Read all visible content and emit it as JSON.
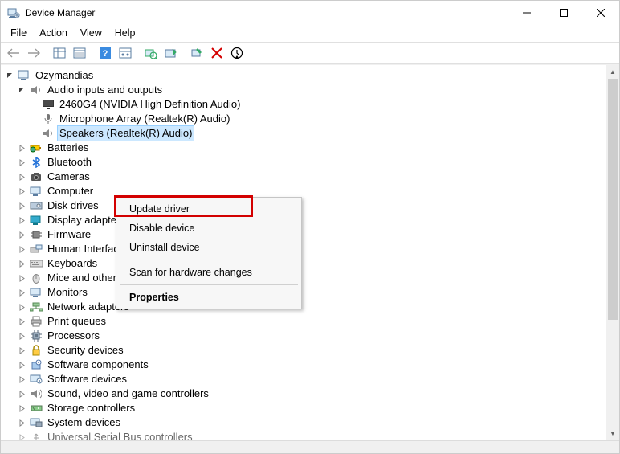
{
  "window": {
    "title": "Device Manager"
  },
  "menu": {
    "file": "File",
    "action": "Action",
    "view": "View",
    "help": "Help"
  },
  "tree": {
    "root": "Ozymandias",
    "audio": {
      "label": "Audio inputs and outputs",
      "children": {
        "c0": "2460G4 (NVIDIA High Definition Audio)",
        "c1": "Microphone Array (Realtek(R) Audio)",
        "c2": "Speakers (Realtek(R) Audio)"
      }
    },
    "categories": {
      "batteries": "Batteries",
      "bluetooth": "Bluetooth",
      "cameras": "Cameras",
      "computer": "Computer",
      "diskdrives": "Disk drives",
      "display": "Display adapters",
      "firmware": "Firmware",
      "hid": "Human Interface Devices",
      "keyboards": "Keyboards",
      "mice": "Mice and other pointing devices",
      "monitors": "Monitors",
      "network": "Network adapters",
      "printqueues": "Print queues",
      "processors": "Processors",
      "security": "Security devices",
      "swcomp": "Software components",
      "swdev": "Software devices",
      "sound": "Sound, video and game controllers",
      "storage": "Storage controllers",
      "system": "System devices",
      "usb": "Universal Serial Bus controllers"
    }
  },
  "context_menu": {
    "update_driver": "Update driver",
    "disable_device": "Disable device",
    "uninstall_device": "Uninstall device",
    "scan": "Scan for hardware changes",
    "properties": "Properties"
  }
}
